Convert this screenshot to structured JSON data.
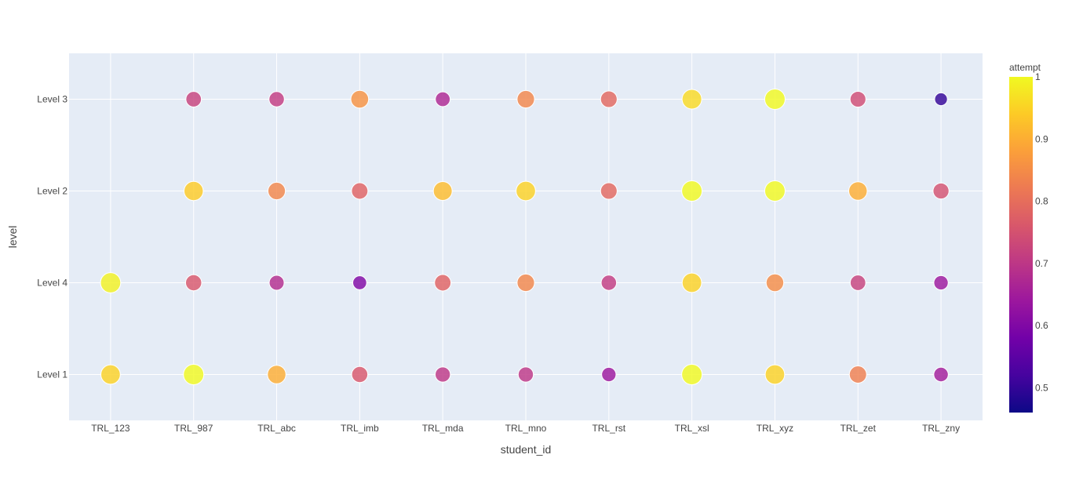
{
  "chart_data": {
    "type": "scatter",
    "title": "",
    "xlabel": "student_id",
    "ylabel": "level",
    "categories_x": [
      "TRL_123",
      "TRL_987",
      "TRL_abc",
      "TRL_imb",
      "TRL_mda",
      "TRL_mno",
      "TRL_rst",
      "TRL_xsl",
      "TRL_xyz",
      "TRL_zet",
      "TRL_zny"
    ],
    "categories_y": [
      "Level 1",
      "Level 4",
      "Level 2",
      "Level 3"
    ],
    "color_scale": {
      "title": "attempt",
      "range": [
        0.46,
        1.0
      ],
      "ticks": [
        1,
        0.9,
        0.8,
        0.7,
        0.6,
        0.5
      ],
      "tick_labels": [
        "1",
        "0.9",
        "0.8",
        "0.7",
        "0.6",
        "0.5"
      ]
    },
    "points": [
      {
        "x": "TRL_123",
        "y": "Level 1",
        "attempt": 0.95
      },
      {
        "x": "TRL_123",
        "y": "Level 4",
        "attempt": 0.99
      },
      {
        "x": "TRL_987",
        "y": "Level 1",
        "attempt": 1.0
      },
      {
        "x": "TRL_987",
        "y": "Level 4",
        "attempt": 0.76
      },
      {
        "x": "TRL_987",
        "y": "Level 2",
        "attempt": 0.94
      },
      {
        "x": "TRL_987",
        "y": "Level 3",
        "attempt": 0.72
      },
      {
        "x": "TRL_abc",
        "y": "Level 1",
        "attempt": 0.9
      },
      {
        "x": "TRL_abc",
        "y": "Level 4",
        "attempt": 0.68
      },
      {
        "x": "TRL_abc",
        "y": "Level 2",
        "attempt": 0.84
      },
      {
        "x": "TRL_abc",
        "y": "Level 3",
        "attempt": 0.71
      },
      {
        "x": "TRL_imb",
        "y": "Level 1",
        "attempt": 0.76
      },
      {
        "x": "TRL_imb",
        "y": "Level 4",
        "attempt": 0.6
      },
      {
        "x": "TRL_imb",
        "y": "Level 2",
        "attempt": 0.78
      },
      {
        "x": "TRL_imb",
        "y": "Level 3",
        "attempt": 0.86
      },
      {
        "x": "TRL_mda",
        "y": "Level 1",
        "attempt": 0.7
      },
      {
        "x": "TRL_mda",
        "y": "Level 4",
        "attempt": 0.78
      },
      {
        "x": "TRL_mda",
        "y": "Level 2",
        "attempt": 0.92
      },
      {
        "x": "TRL_mda",
        "y": "Level 3",
        "attempt": 0.67
      },
      {
        "x": "TRL_mno",
        "y": "Level 1",
        "attempt": 0.7
      },
      {
        "x": "TRL_mno",
        "y": "Level 4",
        "attempt": 0.84
      },
      {
        "x": "TRL_mno",
        "y": "Level 2",
        "attempt": 0.95
      },
      {
        "x": "TRL_mno",
        "y": "Level 3",
        "attempt": 0.84
      },
      {
        "x": "TRL_rst",
        "y": "Level 1",
        "attempt": 0.64
      },
      {
        "x": "TRL_rst",
        "y": "Level 4",
        "attempt": 0.71
      },
      {
        "x": "TRL_rst",
        "y": "Level 2",
        "attempt": 0.79
      },
      {
        "x": "TRL_rst",
        "y": "Level 3",
        "attempt": 0.79
      },
      {
        "x": "TRL_xsl",
        "y": "Level 1",
        "attempt": 1.0
      },
      {
        "x": "TRL_xsl",
        "y": "Level 4",
        "attempt": 0.95
      },
      {
        "x": "TRL_xsl",
        "y": "Level 2",
        "attempt": 1.0
      },
      {
        "x": "TRL_xsl",
        "y": "Level 3",
        "attempt": 0.96
      },
      {
        "x": "TRL_xyz",
        "y": "Level 1",
        "attempt": 0.95
      },
      {
        "x": "TRL_xyz",
        "y": "Level 4",
        "attempt": 0.85
      },
      {
        "x": "TRL_xyz",
        "y": "Level 2",
        "attempt": 1.0
      },
      {
        "x": "TRL_xyz",
        "y": "Level 3",
        "attempt": 1.0
      },
      {
        "x": "TRL_zet",
        "y": "Level 1",
        "attempt": 0.83
      },
      {
        "x": "TRL_zet",
        "y": "Level 4",
        "attempt": 0.72
      },
      {
        "x": "TRL_zet",
        "y": "Level 2",
        "attempt": 0.9
      },
      {
        "x": "TRL_zet",
        "y": "Level 3",
        "attempt": 0.74
      },
      {
        "x": "TRL_zny",
        "y": "Level 1",
        "attempt": 0.65
      },
      {
        "x": "TRL_zny",
        "y": "Level 4",
        "attempt": 0.64
      },
      {
        "x": "TRL_zny",
        "y": "Level 2",
        "attempt": 0.75
      },
      {
        "x": "TRL_zny",
        "y": "Level 3",
        "attempt": 0.5
      }
    ],
    "grid": true,
    "legend": "right",
    "colors": {
      "plot_background": "#E5ECF6",
      "grid": "#ffffff",
      "marker_border": "#ffffff"
    }
  }
}
